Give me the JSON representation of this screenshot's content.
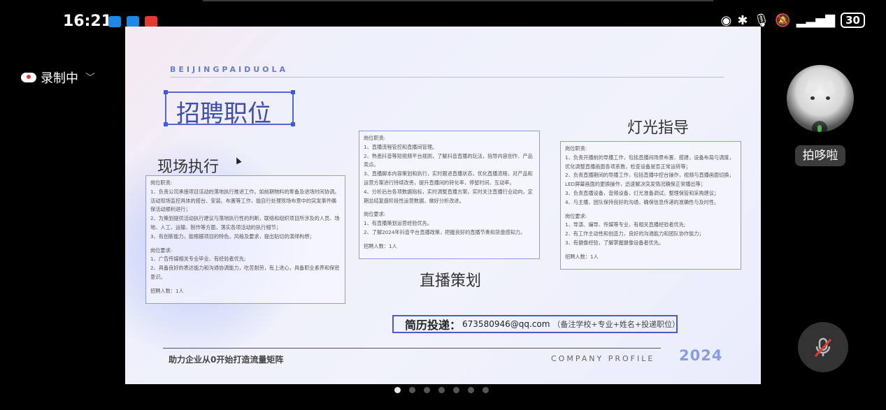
{
  "status_bar": {
    "time": "16:21",
    "battery": "30",
    "app_icon_colors": [
      "#1e88e5",
      "#1e88e5",
      "#e53935"
    ]
  },
  "recording": {
    "label": "录制中"
  },
  "slide": {
    "brand": "BEIJINGPAIDUOLA",
    "title": "招聘职位",
    "sections": {
      "onsite": {
        "title": "现场执行",
        "duty_title": "岗位职责:",
        "duties": [
          "1、负责公司承接项目活动的落地执行推进工作。如前期物料的筹备及进场时间协调。活动现场监控具体的搭台、安装、布置等工作，能自行处理现场布景中的突发事件确保活动顺利进行；",
          "2、为策划提供活动执行建议与落地执行性的判断，联络和组织项目所涉及的人员、场地、人工、运输、制作等方面，落实各项活动的执行细节；",
          "3、有创新能力，能根据项目的特色，风格及要求，提出贴切的演绎构想；"
        ],
        "req_title": "岗位要求:",
        "reqs": [
          "1、广告传媒相关专业毕业、有经验者优先;",
          "2、具备良好的表达能力和沟通协调能力，吃苦耐劳，有上进心，具备职业素养和保密意识。"
        ],
        "headcount": "招聘人数：1人"
      },
      "live": {
        "title": "直播策划",
        "duty_title": "岗位职责:",
        "duties": [
          "1、直播流程管控和直播间管理。",
          "2、熟悉抖音等短视频平台规则，了解抖音直播的玩法，指导内容创作、产品卖点。",
          "3、直播脚本内容策划和执行，实时跟进直播状态，优化直播流程，对产品和运营方案进行持续改善，提升直播间的转化率，停留时间，互动率。",
          "4、分析后台各项数据指标，实时调整直播方案，实时关注直播行业动向，定期总结复盘阶段性运营数据，做好分析改进。"
        ],
        "req_title": "岗位要求:",
        "reqs": [
          "1、有直播策划运营经验优先。",
          "2、了解2024年抖音平台直播政策，把握良好的直播节奏和货盘感知力。"
        ],
        "headcount": "招聘人数：1人"
      },
      "lighting": {
        "title": "灯光指导",
        "duty_title": "岗位职责:",
        "duties": [
          "1、负责开播前的导播工作，包括直播间场景布置、搭建，设备布局与调度，优化调整直播画面各项系数，检查设备是否正常运转等；",
          "2、负责直播期间的导播工作，包括直播中控台操作，视频与直播画面切换，LED屏幕画面的更换操作，迅速解决突发情况确保正常播出等；",
          "3、负责直播设备，音频设备，灯光准备调试，整理保管和采购建议；",
          "4、与主播、团队保持良好的沟通，确保信息传递的准确性与及时性。"
        ],
        "req_title": "岗位要求:",
        "reqs": [
          "1、导演、编导、传媒等专业，有相关直播经验者优先;",
          "2、有工作主动性和创造力，良好的沟通能力和团队协作能力；",
          "3、有摄像经验，了解掌握摄像设备者优先。"
        ],
        "headcount": "招聘人数：1人"
      }
    },
    "resume": {
      "label": "简历投递",
      "email": "673580946@qq.com",
      "note": "（备注学校+专业+姓名+投递职位）"
    },
    "slogan": "助力企业从0开始打造流量矩阵",
    "company": "COMPANY PROFILE",
    "year": "2024"
  },
  "participant": {
    "name": "拍哆啦"
  },
  "pager": {
    "count": 7,
    "active_index": 0
  }
}
